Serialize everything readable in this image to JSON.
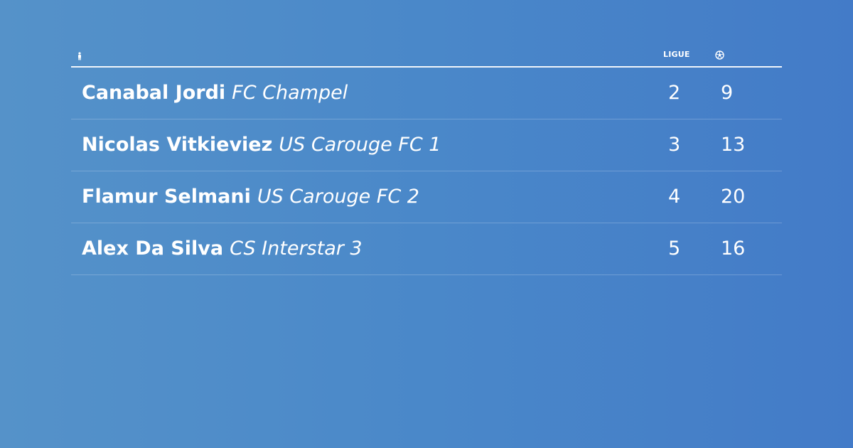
{
  "header": {
    "player_icon": "player-figure-icon",
    "league_label": "LIGUE",
    "goals_icon": "soccer-ball-icon"
  },
  "rows": [
    {
      "player": "Canabal Jordi",
      "club": "FC Champel",
      "league": "2",
      "goals": "9"
    },
    {
      "player": "Nicolas Vitkieviez",
      "club": "US Carouge FC 1",
      "league": "3",
      "goals": "13"
    },
    {
      "player": "Flamur Selmani",
      "club": "US Carouge FC 2",
      "league": "4",
      "goals": "20"
    },
    {
      "player": "Alex Da Silva",
      "club": "CS Interstar 3",
      "league": "5",
      "goals": "16"
    }
  ],
  "colors": {
    "background_start": "#5592c9",
    "background_end": "#437bc8",
    "text": "#ffffff"
  }
}
